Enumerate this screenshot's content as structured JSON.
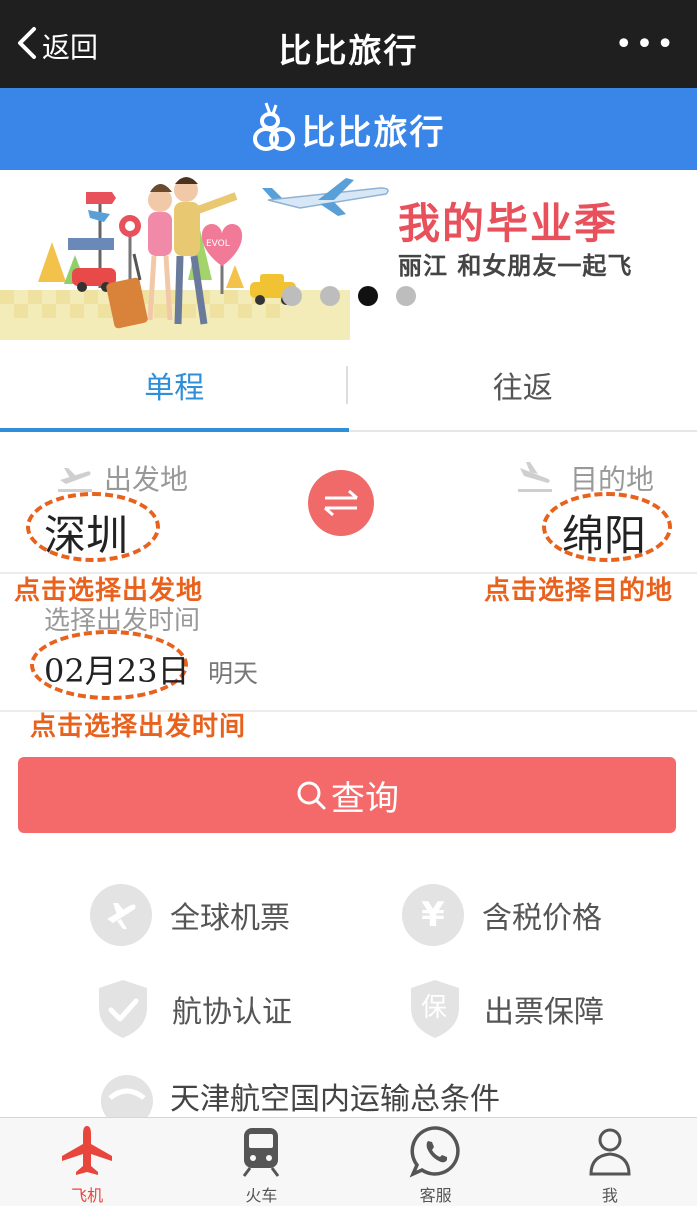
{
  "nav": {
    "back_label": "返回",
    "title": "比比旅行",
    "more_label": "•••"
  },
  "brand": {
    "name": "比比旅行"
  },
  "banner": {
    "title": "我的毕业季",
    "subtitle": "丽江 和女朋友一起飞",
    "sign_text": "EVOL",
    "slides": 4,
    "active_slide": 3
  },
  "tabs": [
    {
      "label": "单程",
      "active": true
    },
    {
      "label": "往返",
      "active": false
    }
  ],
  "route": {
    "from_label": "出发地",
    "to_label": "目的地",
    "from_city": "深圳",
    "to_city": "绵阳"
  },
  "annotations": {
    "from_hint": "点击选择出发地",
    "to_hint": "点击选择目的地",
    "date_hint": "点击选择出发时间",
    "color": "#e8621e"
  },
  "date": {
    "label": "选择出发时间",
    "value": "02月23日",
    "relative": "明天"
  },
  "search": {
    "label": "查询"
  },
  "features": [
    {
      "icon": "plane-circle-icon",
      "label": "全球机票"
    },
    {
      "icon": "yen-circle-icon",
      "label": "含税价格"
    },
    {
      "icon": "shield-check-icon",
      "label": "航协认证"
    },
    {
      "icon": "shield-bao-icon",
      "label": "出票保障"
    }
  ],
  "terms": {
    "label": "天津航空国内运输总条件"
  },
  "tabbar": [
    {
      "label": "飞机",
      "icon": "airplane-icon",
      "active": true
    },
    {
      "label": "火车",
      "icon": "train-icon",
      "active": false
    },
    {
      "label": "客服",
      "icon": "whatsapp-icon",
      "active": false
    },
    {
      "label": "我",
      "icon": "person-icon",
      "active": false
    }
  ],
  "colors": {
    "brand_blue": "#3a86e8",
    "tab_active": "#2f8fd8",
    "search_button": "#f46a6a",
    "tabbar_active": "#e8453c"
  }
}
